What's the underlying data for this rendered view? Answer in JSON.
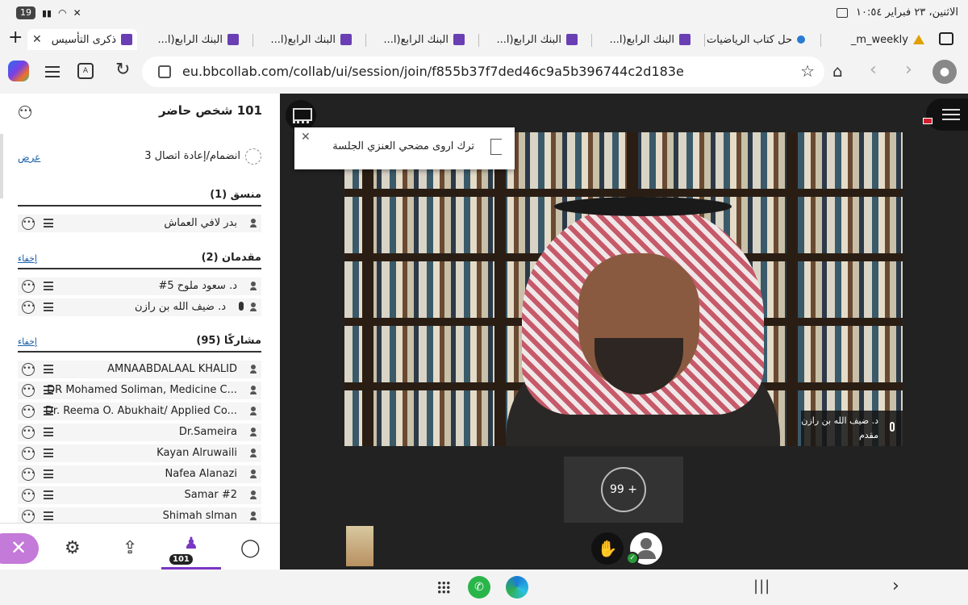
{
  "status": {
    "datetime": "الاثنين، ٢٣ فبراير ١٠:٥٤",
    "battery": "19"
  },
  "tabs": [
    {
      "label": "m_weekly_",
      "active": false
    },
    {
      "label": "حل كتاب الرياضيات",
      "active": false
    },
    {
      "label": "البنك الرابع(ا...",
      "active": false
    },
    {
      "label": "البنك الرابع(ا...",
      "active": false
    },
    {
      "label": "البنك الرابع(ا...",
      "active": false
    },
    {
      "label": "البنك الرابع(ا...",
      "active": false
    },
    {
      "label": "البنك الرابع(ا...",
      "active": false
    },
    {
      "label": "ذكرى التأسيس",
      "active": true
    }
  ],
  "address": {
    "url": "eu.bbcollab.com/collab/ui/session/join/f855b37f7ded46c9a5b396744c2d183e"
  },
  "panel": {
    "title": "101 شخص حاضر",
    "join_label": "انضمام/إعادة اتصال 3",
    "join_link": "عرض",
    "sections": {
      "coordinator": {
        "title": "منسق (1)",
        "rows": [
          "بدر لافي العماش"
        ]
      },
      "presenters": {
        "title": "مقدمان (2)",
        "link": "إخفاء",
        "rows": [
          "د. سعود ملوح 5#",
          "د. ضيف الله بن رازن"
        ]
      },
      "participants": {
        "title": "مشاركًا (95)",
        "link": "إخفاء",
        "rows": [
          "AMNAABDALAAL KHALID",
          "DR Mohamed Soliman, Medicine C...",
          "Dr. Reema O. Abukhait/ Applied Co...",
          "Dr.Sameira",
          "Kayan Alruwaili",
          "Nafea Alanazi",
          "Samar #2",
          "Shimah slman"
        ]
      }
    },
    "attendee_count_badge": "101"
  },
  "stage": {
    "notification": "ترك اروى مضحي العنزي الجلسة",
    "speaker_name": "د. ضيف الله بن رازن",
    "speaker_role": "مقدم",
    "overflow_count": "99 +"
  },
  "colors": {
    "accent": "#7a36c4",
    "close_fab": "#c47ad8",
    "link": "#1a5fa8"
  }
}
